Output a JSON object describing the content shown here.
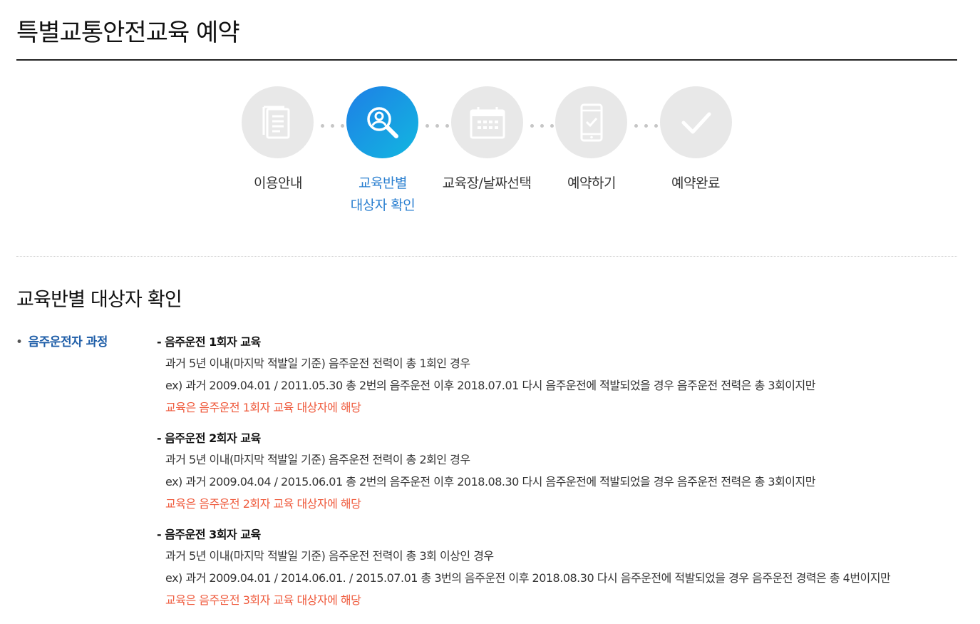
{
  "page": {
    "title": "특별교통안전교육 예약"
  },
  "steps": [
    {
      "label_lines": [
        "이용안내"
      ],
      "icon": "document-icon",
      "active": false
    },
    {
      "label_lines": [
        "교육반별",
        "대상자 확인"
      ],
      "icon": "person-search-icon",
      "active": true
    },
    {
      "label_lines": [
        "교육장/날짜선택"
      ],
      "icon": "calendar-icon",
      "active": false
    },
    {
      "label_lines": [
        "예약하기"
      ],
      "icon": "mobile-check-icon",
      "active": false
    },
    {
      "label_lines": [
        "예약완료"
      ],
      "icon": "check-icon",
      "active": false
    }
  ],
  "colors": {
    "active_start": "#1e7fe6",
    "active_end": "#12b7e0",
    "inactive": "#e8e8e8",
    "highlight": "#ef5a3c",
    "course": "#1f5ea8"
  },
  "section": {
    "title": "교육반별 대상자 확인",
    "course_label": "음주운전자 과정",
    "items": [
      {
        "heading": "- 음주운전 1회자 교육",
        "condition": "과거 5년 이내(마지막 적발일 기준) 음주운전 전력이 총 1회인 경우",
        "example": "ex) 과거 2009.04.01 / 2011.05.30 총 2번의 음주운전 이후 2018.07.01 다시 음주운전에 적발되었을 경우 음주운전 전력은 총 3회이지만",
        "note": "교육은 음주운전 1회자 교육 대상자에 해당"
      },
      {
        "heading": "- 음주운전 2회자 교육",
        "condition": "과거 5년 이내(마지막 적발일 기준) 음주운전 전력이 총 2회인 경우",
        "example": "ex) 과거 2009.04.04 / 2015.06.01 총 2번의 음주운전 이후 2018.08.30 다시 음주운전에 적발되었을 경우 음주운전 전력은 총 3회이지만",
        "note": "교육은 음주운전 2회자 교육 대상자에 해당"
      },
      {
        "heading": "- 음주운전 3회자 교육",
        "condition": "과거 5년 이내(마지막 적발일 기준) 음주운전 전력이 총 3회 이상인 경우",
        "example": "ex) 과거 2009.04.01 / 2014.06.01. / 2015.07.01 총 3번의 음주운전 이후 2018.08.30 다시 음주운전에 적발되었을 경우 음주운전 경력은 총 4번이지만",
        "note": "교육은 음주운전 3회자 교육 대상자에 해당"
      }
    ]
  }
}
